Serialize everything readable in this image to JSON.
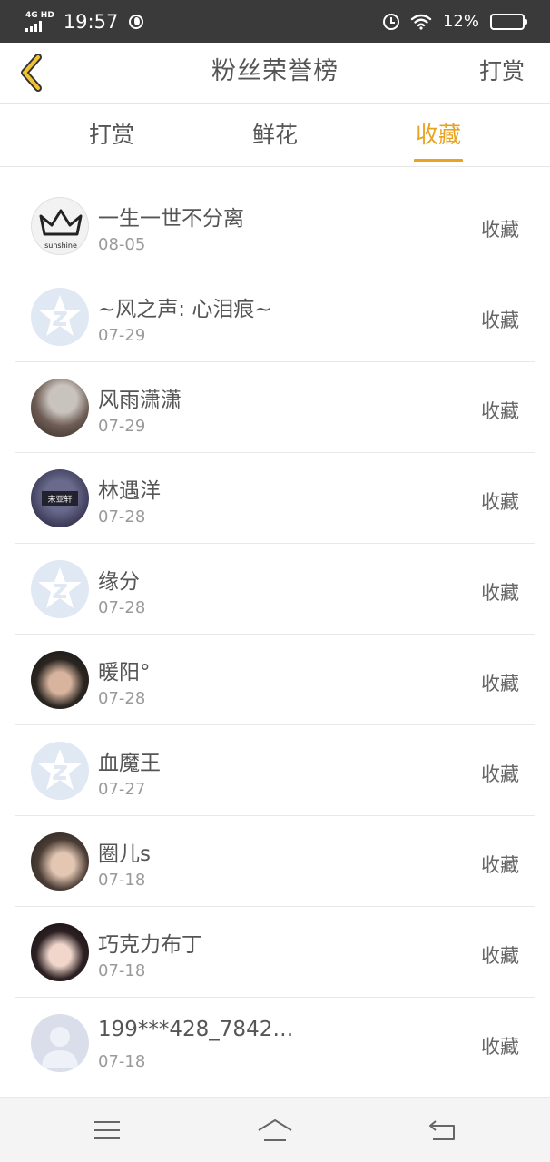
{
  "status_bar": {
    "network": "4G HD",
    "time": "19:57",
    "battery_percent": "12%",
    "battery_level": 0.12,
    "icons": [
      "signal-icon",
      "globe-icon",
      "alarm-icon",
      "wifi-icon",
      "battery-icon"
    ]
  },
  "nav": {
    "title": "粉丝荣誉榜",
    "action_label": "打赏",
    "back_icon": "chevron-left-icon"
  },
  "tabs": [
    {
      "label": "打赏",
      "active": false
    },
    {
      "label": "鲜花",
      "active": false
    },
    {
      "label": "收藏",
      "active": true
    }
  ],
  "accent_color": "#e8a321",
  "fans": [
    {
      "name": "一生一世不分离",
      "date": "08-05",
      "type": "收藏",
      "avatar": "crown-avatar",
      "avatar_text": "sunshine"
    },
    {
      "name": "~风之声: 心泪痕~",
      "date": "07-29",
      "type": "收藏",
      "avatar": "qq-default-avatar"
    },
    {
      "name": "风雨潇潇",
      "date": "07-29",
      "type": "收藏",
      "avatar": "photo-avatar"
    },
    {
      "name": "林遇洋",
      "date": "07-28",
      "type": "收藏",
      "avatar": "sign-photo-avatar",
      "avatar_text": "宋亚轩"
    },
    {
      "name": "缘分",
      "date": "07-28",
      "type": "收藏",
      "avatar": "qq-default-avatar"
    },
    {
      "name": "暖阳°",
      "date": "07-28",
      "type": "收藏",
      "avatar": "photo-avatar"
    },
    {
      "name": "血魔王",
      "date": "07-27",
      "type": "收藏",
      "avatar": "qq-default-avatar"
    },
    {
      "name": "圈儿s",
      "date": "07-18",
      "type": "收藏",
      "avatar": "photo-avatar"
    },
    {
      "name": "巧克力布丁",
      "date": "07-18",
      "type": "收藏",
      "avatar": "photo-avatar"
    },
    {
      "name": "199***428_7842…",
      "date": "07-18",
      "type": "收藏",
      "avatar": "default-person-avatar"
    }
  ],
  "bottom_nav": {
    "icons": [
      "menu-icon",
      "home-icon",
      "back-icon"
    ]
  }
}
